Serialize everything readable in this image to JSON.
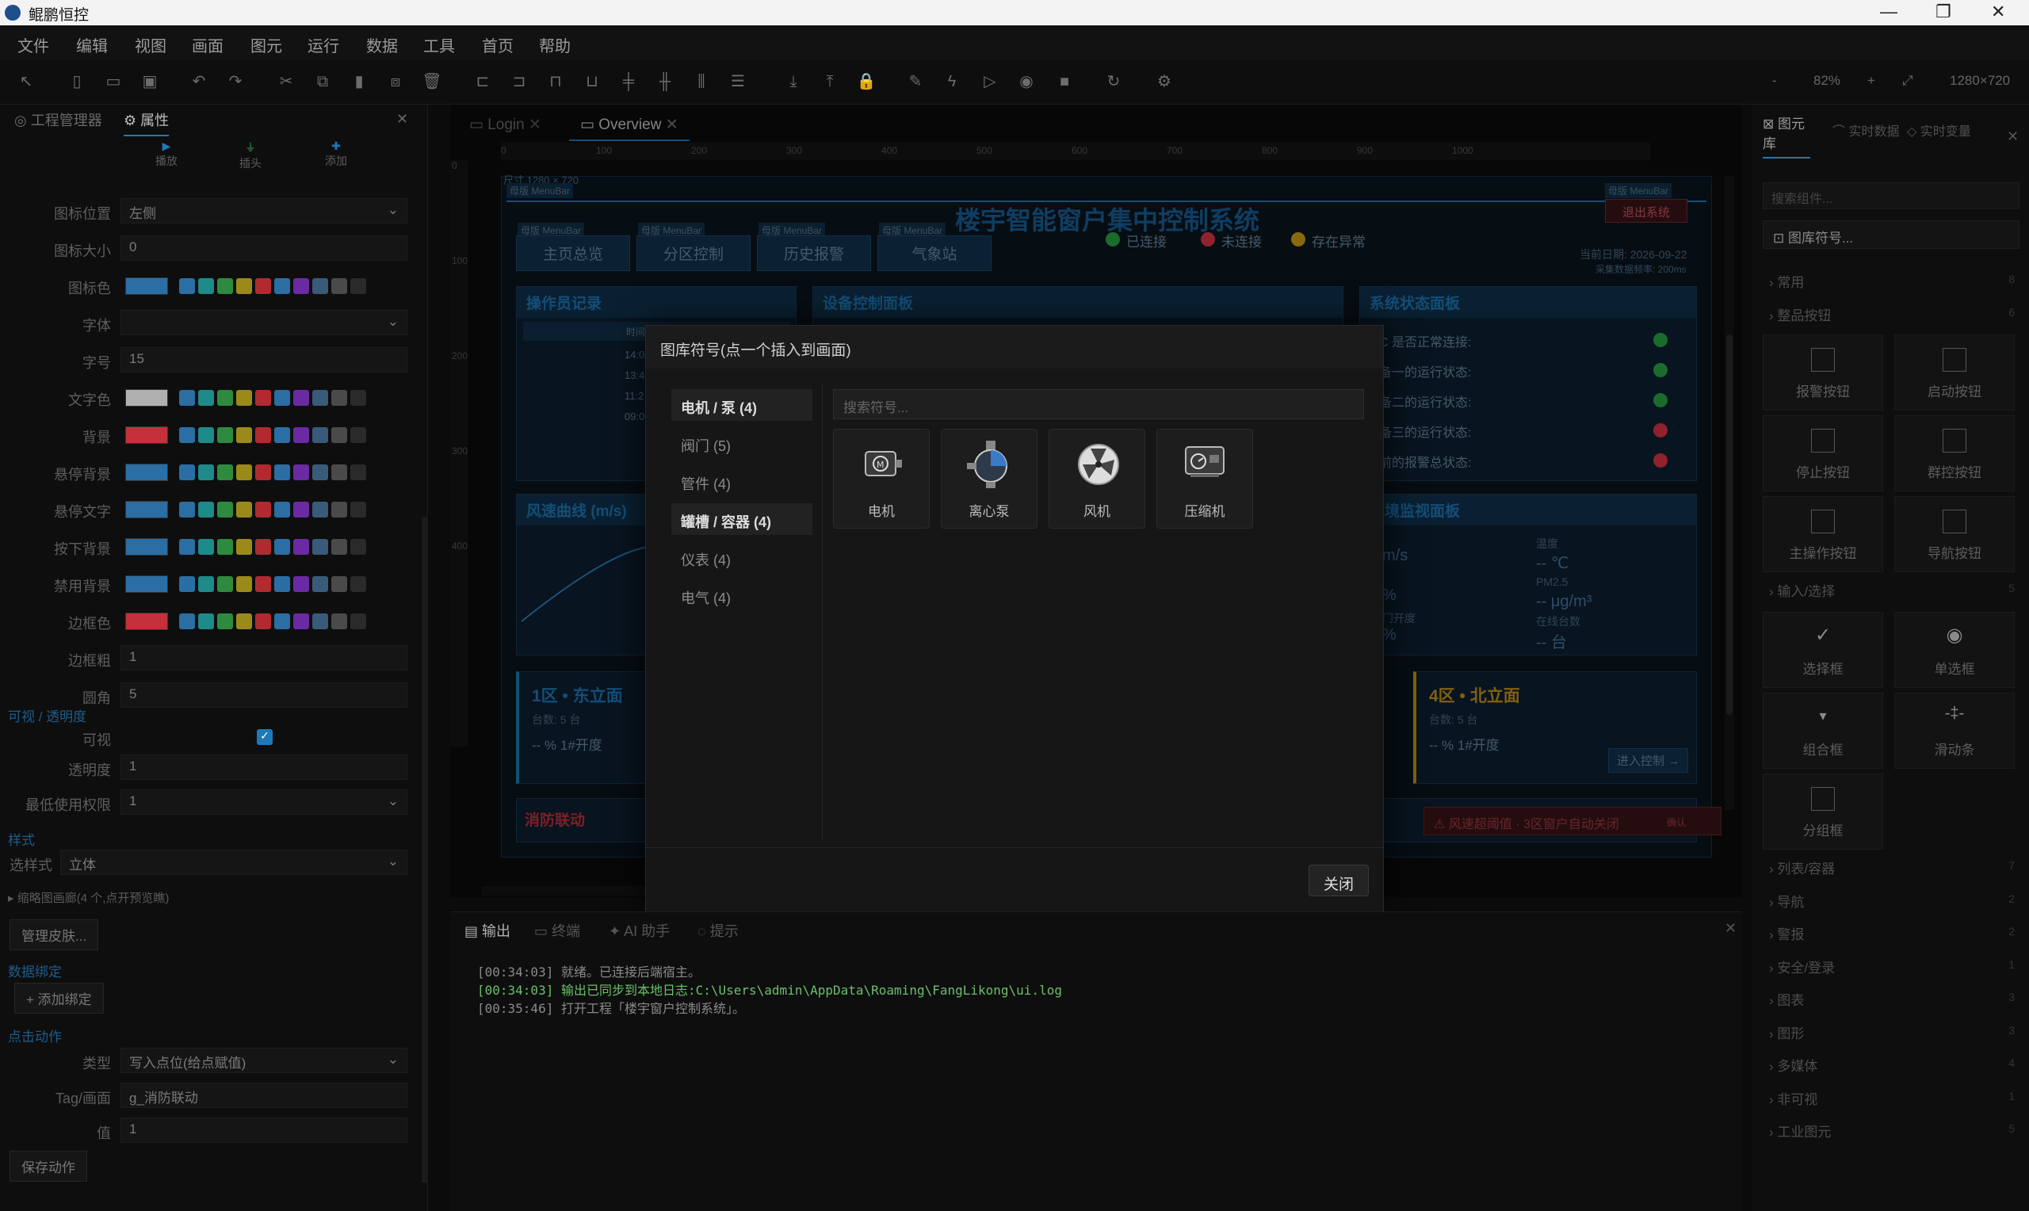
{
  "window": {
    "title": "鲲鹏恒控",
    "minimize": "—",
    "maximize": "❐",
    "close": "✕"
  },
  "menu": [
    "文件",
    "编辑",
    "视图",
    "画面",
    "图元",
    "运行",
    "数据",
    "工具",
    "首页",
    "帮助"
  ],
  "zoom": {
    "minus": "-",
    "value": "82%",
    "plus": "+",
    "resolution": "1280×720"
  },
  "left": {
    "tabs": [
      "工程管理器",
      "属性"
    ],
    "quick": [
      "播放",
      "插头",
      "添加"
    ],
    "props": [
      {
        "label": "图标位置",
        "value": "左侧",
        "type": "select"
      },
      {
        "label": "图标大小",
        "value": "0",
        "type": "text"
      },
      {
        "label": "图标色",
        "type": "color",
        "color": "#2a6ea3"
      },
      {
        "label": "字体",
        "value": "",
        "type": "select"
      },
      {
        "label": "字号",
        "value": "15",
        "type": "text"
      },
      {
        "label": "文字色",
        "type": "color",
        "color": "#b0b0b0"
      },
      {
        "label": "背景",
        "type": "color",
        "color": "#c4303c"
      },
      {
        "label": "悬停背景",
        "type": "color",
        "color": "#2a6ea3"
      },
      {
        "label": "悬停文字",
        "type": "color",
        "color": "#2a6ea3"
      },
      {
        "label": "按下背景",
        "type": "color",
        "color": "#2a6ea3"
      },
      {
        "label": "禁用背景",
        "type": "color",
        "color": "#2a6ea3"
      },
      {
        "label": "边框色",
        "type": "color",
        "color": "#c4303c"
      },
      {
        "label": "边框粗",
        "value": "1",
        "type": "text"
      },
      {
        "label": "圆角",
        "value": "5",
        "type": "text"
      }
    ],
    "visibility_section": "可视 / 透明度",
    "visible_label": "可视",
    "opacity_label": "透明度",
    "opacity_value": "1",
    "permission_label": "最低使用权限",
    "permission_value": "1",
    "style_section": "样式",
    "style_label": "选样式",
    "style_value": "立体",
    "thumb_label": "▸ 缩略图画廊(4 个,点开预览瞧)",
    "manage_skin": "管理皮肤...",
    "binding_section": "数据绑定",
    "add_binding": "+ 添加绑定",
    "click_section": "点击动作",
    "type_label": "类型",
    "type_value": "写入点位(给点赋值)",
    "tag_label": "Tag/画面",
    "tag_value": "g_消防联动",
    "val_label": "值",
    "val_value": "1",
    "save_action": "保存动作"
  },
  "doc_tabs": [
    "Login",
    "Overview"
  ],
  "ruler": [
    "0",
    "100",
    "200",
    "300",
    "400",
    "500",
    "600",
    "700",
    "800",
    "900",
    "1000"
  ],
  "vruler": [
    "0",
    "100",
    "200",
    "300",
    "400"
  ],
  "design": {
    "size_note": "尺寸 1280 × 720",
    "menubar_tag": "母版 MenuBar",
    "title": "楼宇智能窗户集中控制系统",
    "logout": "退出系统",
    "nav": [
      "主页总览",
      "分区控制",
      "历史报警",
      "气象站"
    ],
    "status": [
      "已连接",
      "未连接",
      "存在异常"
    ],
    "date": "当前日期:  2026-09-22",
    "rate": "采集数据频率: 200ms",
    "op_log": "操作员记录",
    "op_header": "时间",
    "op_times": [
      "14:0",
      "13:4",
      "11:2",
      "09:0"
    ],
    "device_panel": "设备控制面板",
    "sys_panel": "系统状态面板",
    "sys_rows": [
      "C 是否正常连接:",
      "备一的运行状态:",
      "备二的运行状态:",
      "备三的运行状态:",
      "前的报警总状态:"
    ],
    "wind": "风速曲线 (m/s)",
    "env_panel": "环境监视面板",
    "env_left": [
      "m/s",
      "%",
      "门开度",
      "%"
    ],
    "env_right": [
      "温度",
      "-- ℃",
      "PM2.5",
      "-- μg/m³",
      "在线台数",
      "-- 台"
    ],
    "zone1": "1区 • 东立面",
    "zone1_count": "台数: 5 台",
    "zone1_open": "-- % 1#开度",
    "zone4": "4区 • 北立面",
    "zone4_count": "台数: 5 台",
    "zone4_open": "-- % 1#开度",
    "enter": "进入控制 →",
    "fire": "消防联动",
    "alarm": "风速超阈值 · 3区窗户自动关闭",
    "alarm_btn": "确认"
  },
  "dialog": {
    "title": "图库符号(点一个插入到画面)",
    "categories": [
      "电机 / 泵 (4)",
      "阀门 (5)",
      "管件 (4)",
      "罐槽 / 容器 (4)",
      "仪表 (4)",
      "电气 (4)"
    ],
    "search_placeholder": "搜索符号...",
    "symbols": [
      "电机",
      "离心泵",
      "风机",
      "压缩机"
    ],
    "close": "关闭"
  },
  "right": {
    "tabs": [
      "图元库",
      "实时数据",
      "实时变量"
    ],
    "search_placeholder": "搜索组件...",
    "symbol_btn": "图库符号...",
    "cats_top": [
      [
        "常用",
        "8"
      ],
      [
        "整品按钮",
        "6"
      ]
    ],
    "buttons": [
      "报警按钮",
      "启动按钮",
      "停止按钮",
      "群控按钮",
      "主操作按钮",
      "导航按钮"
    ],
    "input_cat": [
      "输入/选择",
      "5"
    ],
    "inputs": [
      "选择框",
      "单选框",
      "组合框",
      "滑动条",
      "分组框"
    ],
    "cats_bottom": [
      [
        "列表/容器",
        "7"
      ],
      [
        "导航",
        "2"
      ],
      [
        "警报",
        "2"
      ],
      [
        "安全/登录",
        "1"
      ],
      [
        "图表",
        "3"
      ],
      [
        "图形",
        "3"
      ],
      [
        "多媒体",
        "4"
      ],
      [
        "非可视",
        "1"
      ],
      [
        "工业图元",
        "5"
      ]
    ]
  },
  "bottom": {
    "tabs": [
      "输出",
      "终端",
      "AI 助手",
      "提示"
    ],
    "logs": [
      {
        "text": "[00:34:03] 就绪。已连接后端宿主。",
        "color": "#8a8a8a"
      },
      {
        "text": "[00:34:03] 输出已同步到本地日志:C:\\Users\\admin\\AppData\\Roaming\\FangLikong\\ui.log",
        "color": "#6bbf6b"
      },
      {
        "text": "[00:35:46] 打开工程「楼宇窗户控制系统」。",
        "color": "#8a8a8a"
      }
    ]
  },
  "colors": {
    "accent": "#1e79b8",
    "ok": "#28a745",
    "bad": "#dc3545",
    "warn": "#d4a017"
  }
}
